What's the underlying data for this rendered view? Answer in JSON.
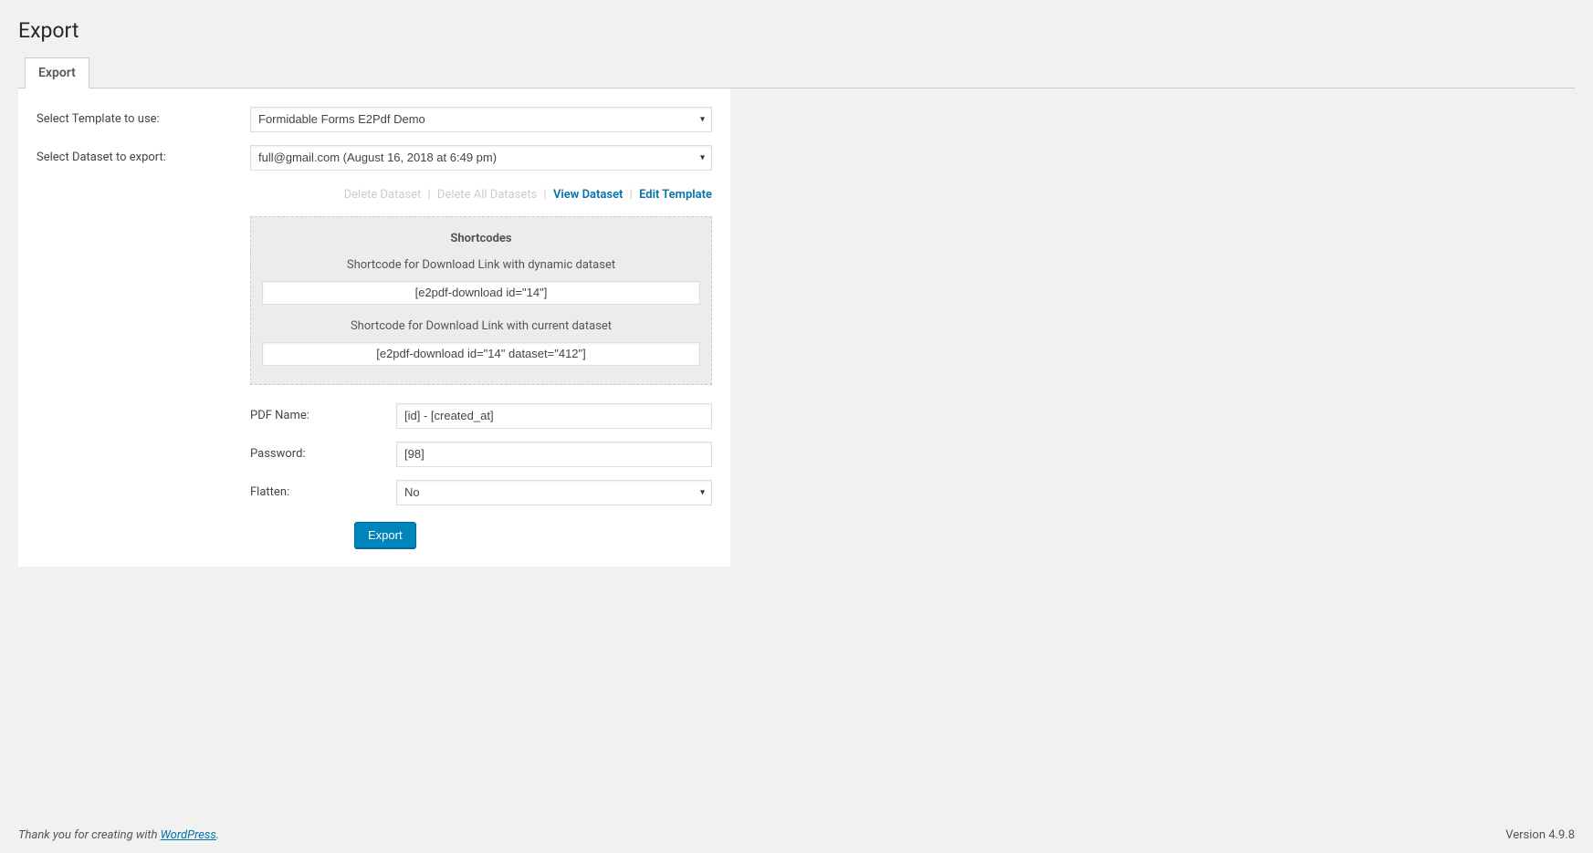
{
  "page": {
    "title": "Export"
  },
  "tabs": [
    {
      "label": "Export"
    }
  ],
  "form": {
    "template_label": "Select Template to use:",
    "template_value": "Formidable Forms E2Pdf Demo",
    "dataset_label": "Select Dataset to export:",
    "dataset_value": "full@gmail.com (August 16, 2018 at 6:49 pm)"
  },
  "actions": {
    "delete_dataset": "Delete Dataset",
    "delete_all": "Delete All Datasets",
    "view_dataset": "View Dataset",
    "edit_template": "Edit Template"
  },
  "shortcodes": {
    "title": "Shortcodes",
    "desc1": "Shortcode for Download Link with dynamic dataset",
    "code1": "[e2pdf-download id=\"14\"]",
    "desc2": "Shortcode for Download Link with current dataset",
    "code2": "[e2pdf-download id=\"14\" dataset=\"412\"]"
  },
  "settings": {
    "pdf_name_label": "PDF Name:",
    "pdf_name_value": "[id] - [created_at]",
    "password_label": "Password:",
    "password_value": "[98]",
    "flatten_label": "Flatten:",
    "flatten_value": "No"
  },
  "buttons": {
    "export": "Export"
  },
  "footer": {
    "thank_prefix": "Thank you for creating with ",
    "wordpress": "WordPress",
    "period": ".",
    "version": "Version 4.9.8"
  }
}
